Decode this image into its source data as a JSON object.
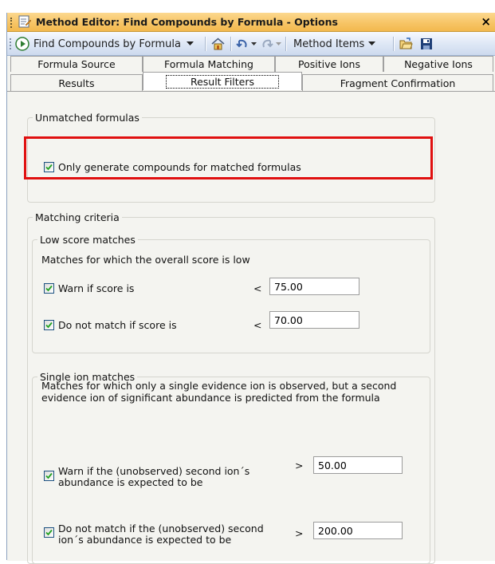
{
  "window": {
    "title": "Method Editor: Find Compounds by Formula - Options",
    "close_glyph": "×"
  },
  "toolbar": {
    "method_label": "Find Compounds by Formula",
    "method_items_label": "Method Items"
  },
  "tabs": {
    "row1": [
      "Formula Source",
      "Formula Matching",
      "Positive Ions",
      "Negative Ions"
    ],
    "row2": [
      "Results",
      "Result Filters",
      "Fragment Confirmation"
    ],
    "active": "Result Filters"
  },
  "unmatched": {
    "legend": "Unmatched formulas",
    "only_generate_label": "Only generate compounds for matched formulas",
    "only_generate_checked": true
  },
  "matching": {
    "legend": "Matching criteria",
    "low_score": {
      "legend": "Low score matches",
      "description": "Matches for which the overall score is low",
      "warn_label": "Warn if score is",
      "warn_operator": "<",
      "warn_value": "75.00",
      "warn_checked": true,
      "nomatch_label": "Do not match if score is",
      "nomatch_operator": "<",
      "nomatch_value": "70.00",
      "nomatch_checked": true
    },
    "single_ion": {
      "legend": "Single ion matches",
      "description_line1": "Matches for which only a single evidence ion is observed, but a second",
      "description_line2": "evidence ion of significant abundance is predicted from the formula",
      "warn_label_line1": "Warn if the (unobserved) second ion´s",
      "warn_label_line2": "abundance is expected to be",
      "warn_operator": ">",
      "warn_value": "50.00",
      "warn_checked": true,
      "nomatch_label_line1": "Do not match if the (unobserved) second",
      "nomatch_label_line2": "ion´s abundance is expected to be",
      "nomatch_operator": ">",
      "nomatch_value": "200.00",
      "nomatch_checked": true
    }
  },
  "colors": {
    "highlight": "#e01010",
    "title_bar": "#f7c566",
    "toolbar": "#dfe8f6"
  }
}
